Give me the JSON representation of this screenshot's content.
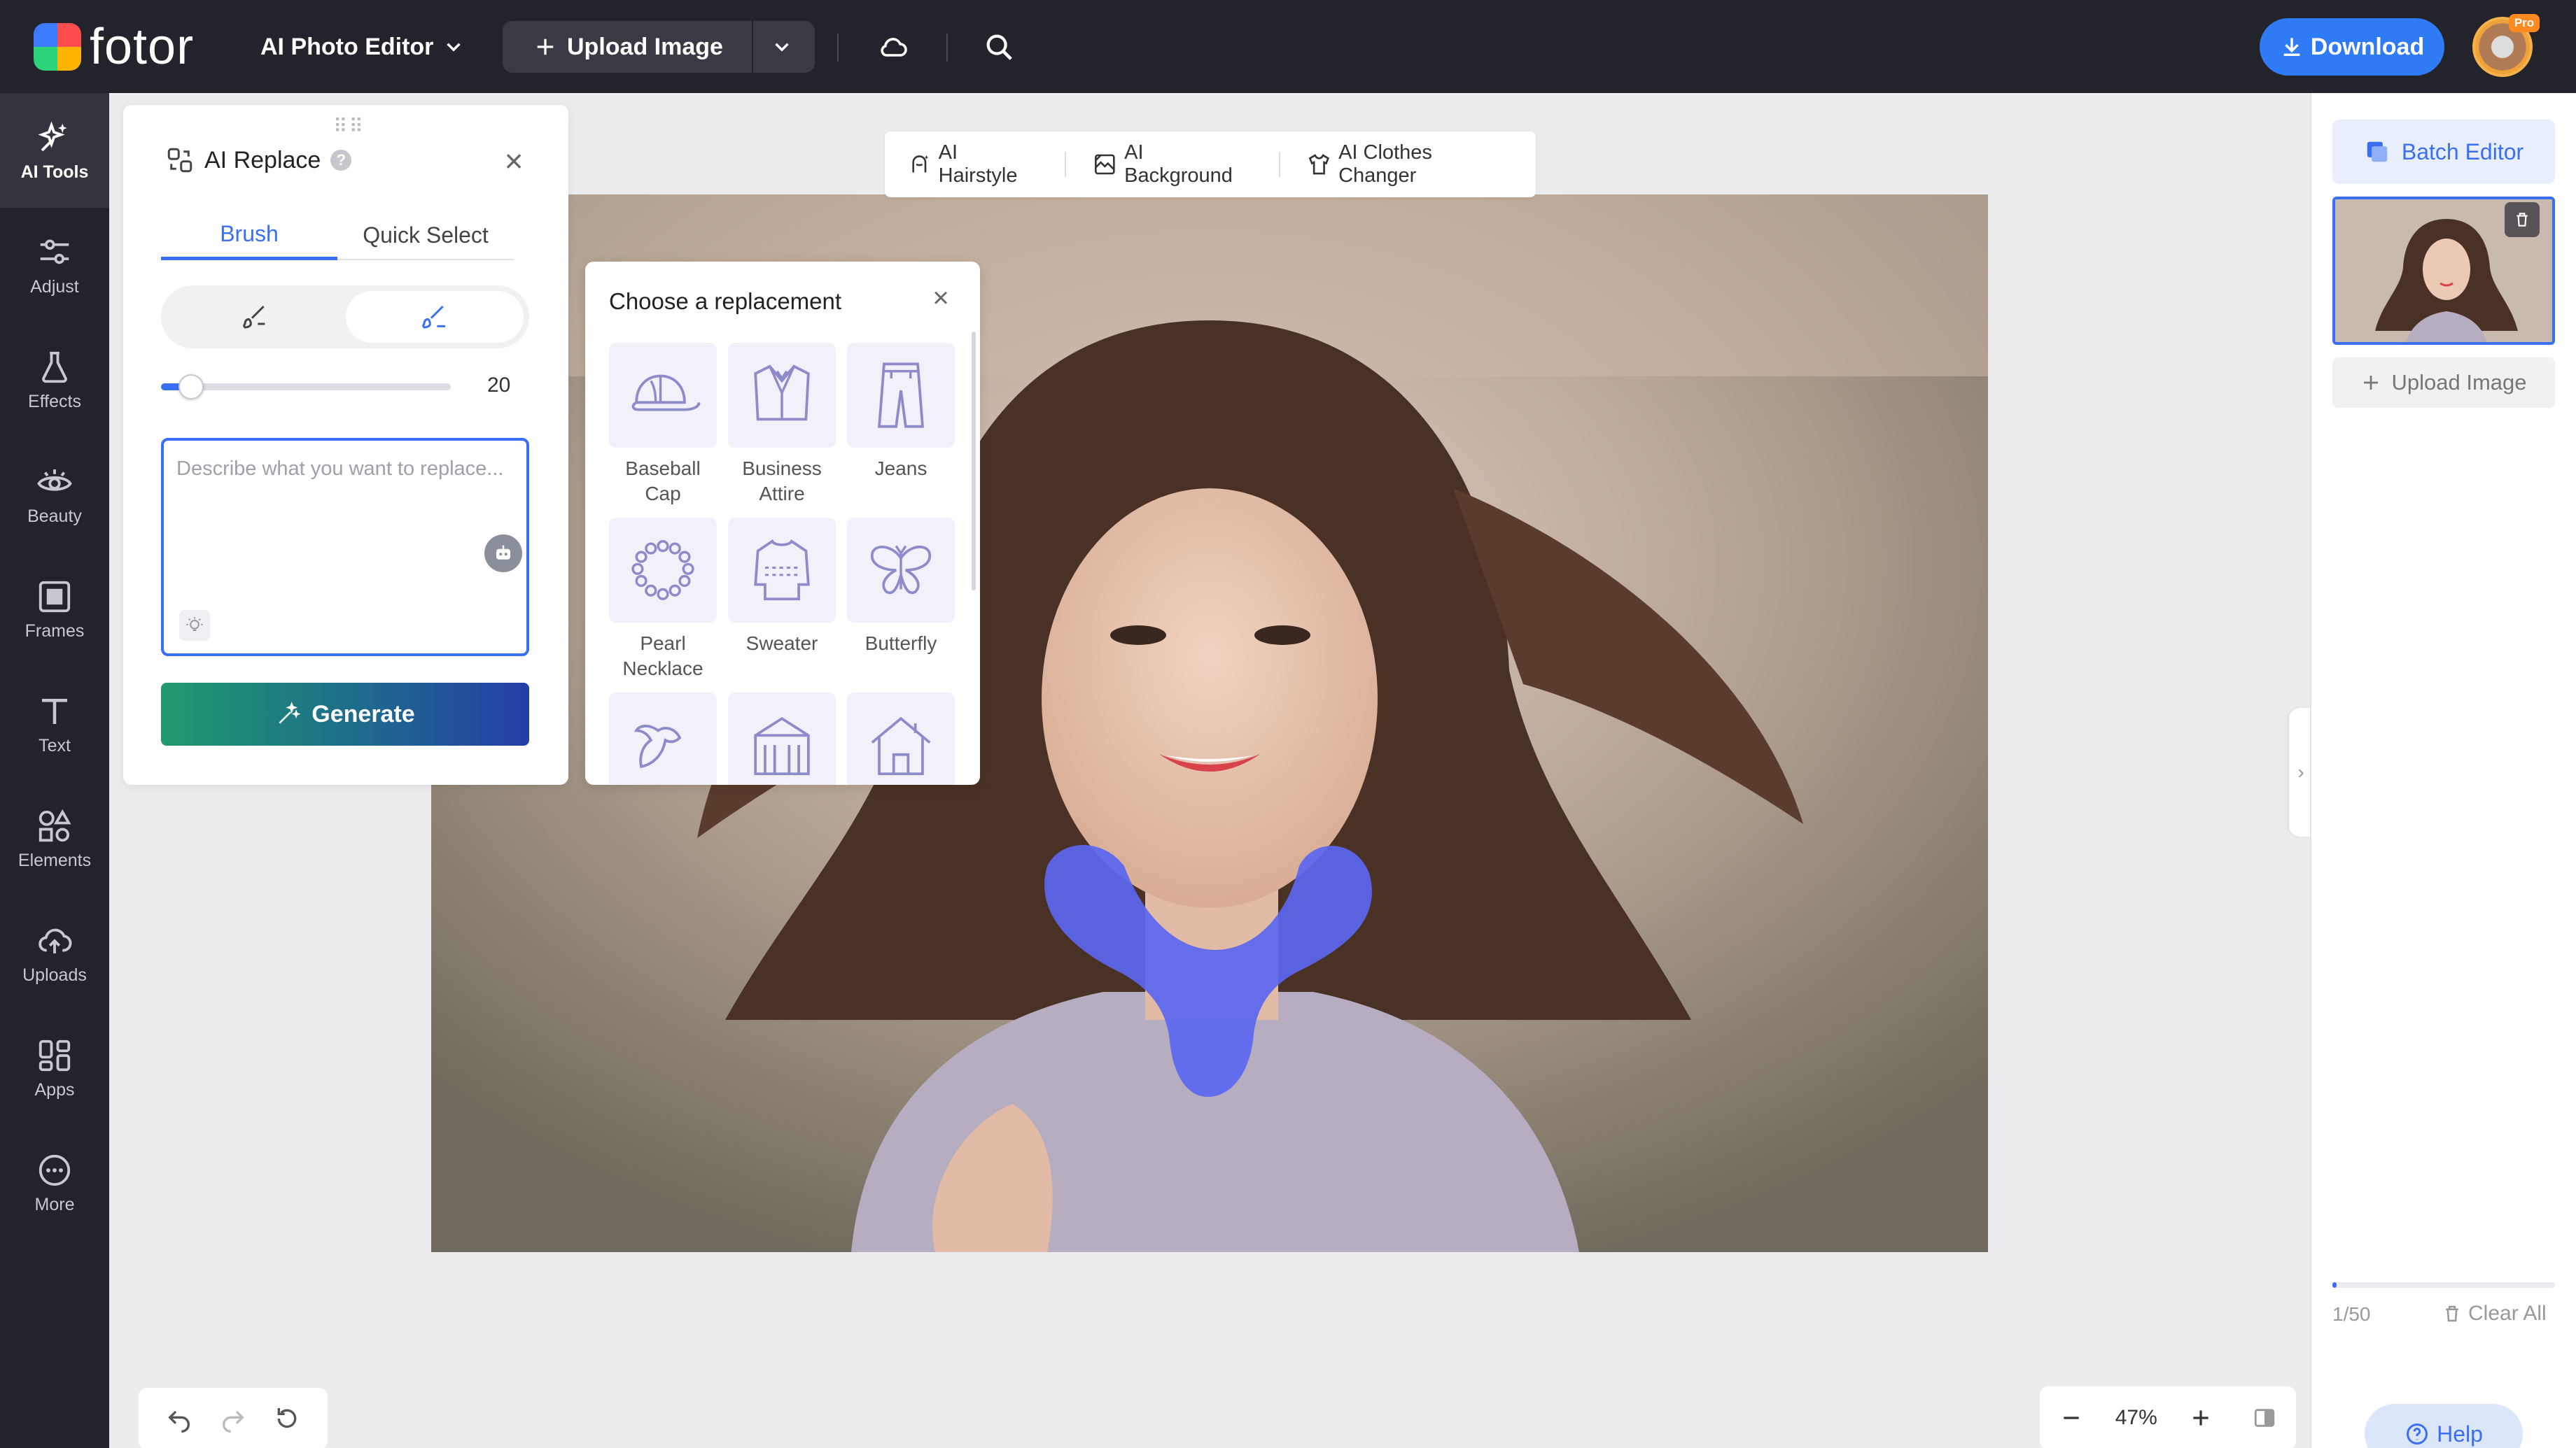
{
  "topbar": {
    "logo_text": "fotor",
    "editor_menu": "AI Photo Editor",
    "upload_label": "Upload Image",
    "download_label": "Download",
    "pro_badge": "Pro"
  },
  "leftnav": {
    "items": [
      {
        "label": "AI Tools",
        "icon": "sparkle-icon",
        "active": true
      },
      {
        "label": "Adjust",
        "icon": "sliders-icon"
      },
      {
        "label": "Effects",
        "icon": "flask-icon"
      },
      {
        "label": "Beauty",
        "icon": "eye-icon"
      },
      {
        "label": "Frames",
        "icon": "frame-icon"
      },
      {
        "label": "Text",
        "icon": "text-icon"
      },
      {
        "label": "Elements",
        "icon": "shapes-icon"
      },
      {
        "label": "Uploads",
        "icon": "cloud-upload-icon"
      },
      {
        "label": "Apps",
        "icon": "apps-icon"
      },
      {
        "label": "More",
        "icon": "more-icon"
      }
    ]
  },
  "panel": {
    "title": "AI Replace",
    "help": "?",
    "tabs": [
      {
        "label": "Brush",
        "active": true
      },
      {
        "label": "Quick Select"
      }
    ],
    "brush_size": "20",
    "brush_size_fraction": 0.08,
    "prompt_placeholder": "Describe what you want to replace...",
    "generate_label": "Generate"
  },
  "picker": {
    "title": "Choose a replacement",
    "items": [
      {
        "label": "Baseball Cap",
        "icon": "baseball-cap-icon"
      },
      {
        "label": "Business Attire",
        "icon": "business-attire-icon"
      },
      {
        "label": "Jeans",
        "icon": "jeans-icon"
      },
      {
        "label": "Pearl Necklace",
        "icon": "pearl-necklace-icon"
      },
      {
        "label": "Sweater",
        "icon": "sweater-icon"
      },
      {
        "label": "Butterfly",
        "icon": "butterfly-icon"
      }
    ]
  },
  "chips": [
    {
      "label": "AI Hairstyle",
      "icon": "hairstyle-icon"
    },
    {
      "label": "AI Background",
      "icon": "background-icon"
    },
    {
      "label": "AI Clothes Changer",
      "icon": "clothes-icon"
    }
  ],
  "right": {
    "batch_label": "Batch Editor",
    "upload_label": "Upload Image",
    "count": "1/50",
    "count_fraction": 0.02,
    "clear_label": "Clear All",
    "help_label": "Help"
  },
  "zoom": {
    "value": "47%"
  },
  "colors": {
    "accent": "#3b6ff3",
    "mask": "#5b66f0",
    "topbar": "#23232b"
  }
}
